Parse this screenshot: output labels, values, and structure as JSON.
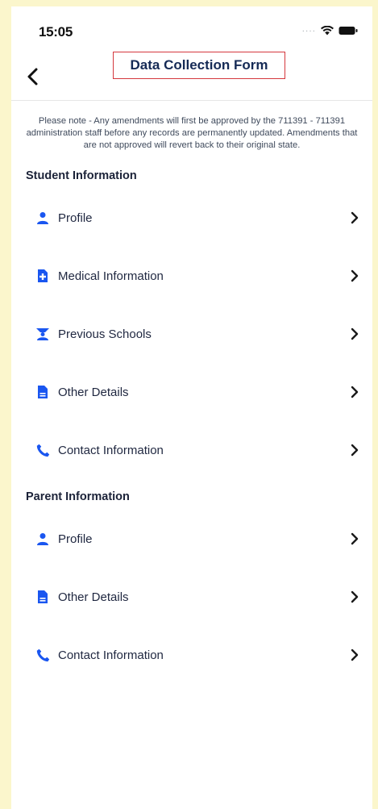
{
  "status_bar": {
    "time": "15:05"
  },
  "nav": {
    "title": "Data Collection Form"
  },
  "notice": "Please note - Any amendments will first be approved by the 711391 - 711391 administration staff before any records are permanently updated. Amendments that are not approved will revert back to their original state.",
  "student_section": {
    "header": "Student Information",
    "items": [
      {
        "label": "Profile",
        "icon": "person-icon"
      },
      {
        "label": "Medical Information",
        "icon": "medical-document-icon"
      },
      {
        "label": "Previous Schools",
        "icon": "school-icon"
      },
      {
        "label": "Other Details",
        "icon": "document-icon"
      },
      {
        "label": "Contact Information",
        "icon": "phone-icon"
      }
    ]
  },
  "parent_section": {
    "header": "Parent Information",
    "items": [
      {
        "label": "Profile",
        "icon": "person-icon"
      },
      {
        "label": "Other Details",
        "icon": "document-icon"
      },
      {
        "label": "Contact Information",
        "icon": "phone-icon"
      }
    ]
  },
  "colors": {
    "accent": "#1a56f0",
    "title": "#152a55",
    "highlight_border": "#d4373d",
    "background": "#fbf6cc"
  }
}
